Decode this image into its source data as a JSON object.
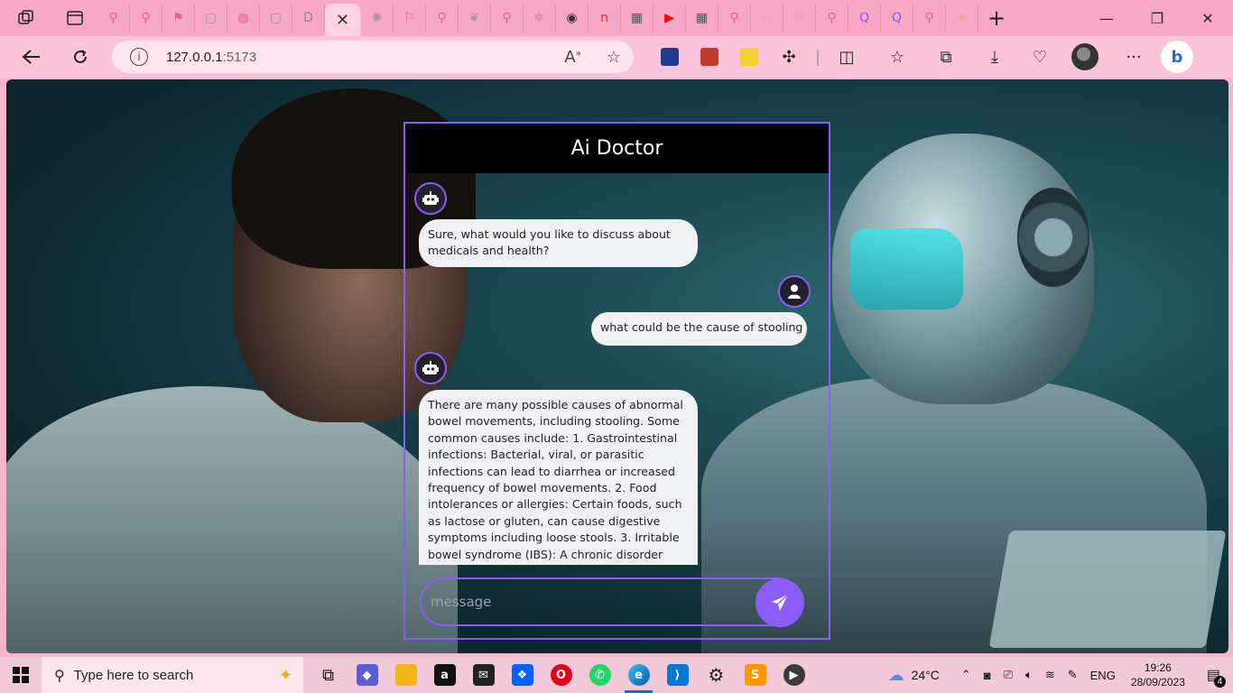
{
  "browser": {
    "tabs": [
      {
        "icon": "search-icon",
        "color": "#e06090"
      },
      {
        "icon": "search-icon",
        "color": "#e06090"
      },
      {
        "icon": "pin-icon",
        "color": "#e06090"
      },
      {
        "icon": "document-icon",
        "color": "#999999"
      },
      {
        "icon": "globe-icon",
        "color": "#e06090"
      },
      {
        "icon": "document-icon",
        "color": "#999999"
      },
      {
        "icon": "d-letter-icon",
        "color": "#888888"
      },
      {
        "icon": "close-icon",
        "color": "#333333",
        "active": true
      },
      {
        "icon": "openai-icon",
        "color": "#999999"
      },
      {
        "icon": "flag-icon",
        "color": "#e06090"
      },
      {
        "icon": "search-icon",
        "color": "#e06090"
      },
      {
        "icon": "leaf-icon",
        "color": "#999999"
      },
      {
        "icon": "search-icon",
        "color": "#e06090"
      },
      {
        "icon": "react-icon",
        "color": "#e06090"
      },
      {
        "icon": "meet-icon",
        "color": "#333333"
      },
      {
        "icon": "n-letter-icon",
        "color": "#d03030"
      },
      {
        "icon": "table-icon",
        "color": "#555555"
      },
      {
        "icon": "youtube-icon",
        "color": "#ff0000"
      },
      {
        "icon": "table-icon",
        "color": "#555555"
      },
      {
        "icon": "search-icon",
        "color": "#e06090"
      },
      {
        "icon": "sort-icon",
        "color": "#ff9bbb"
      },
      {
        "icon": "sort-icon",
        "color": "#ff9bbb"
      },
      {
        "icon": "search-icon",
        "color": "#e06090"
      },
      {
        "icon": "q-letter-icon",
        "color": "#7b5cf0"
      },
      {
        "icon": "q-letter-icon",
        "color": "#7b5cf0"
      },
      {
        "icon": "search-icon",
        "color": "#e06090"
      },
      {
        "icon": "star-icon",
        "color": "#ff9b7a"
      }
    ],
    "address": {
      "host": "127.0.0.1",
      "port": ":5173"
    }
  },
  "app": {
    "title": "Ai Doctor",
    "messages": [
      {
        "sender": "bot",
        "text": "Sure, what would you like to discuss about medicals and health?"
      },
      {
        "sender": "user",
        "text": "what could be the cause of stooling"
      },
      {
        "sender": "bot",
        "text": "There are many possible causes of abnormal bowel movements, including stooling. Some common causes include: 1. Gastrointestinal infections: Bacterial, viral, or parasitic infections can lead to diarrhea or increased frequency of bowel movements. 2. Food intolerances or allergies: Certain foods, such as lactose or gluten, can cause digestive symptoms including loose stools. 3. Irritable bowel syndrome (IBS): A chronic disorder"
      }
    ],
    "input": {
      "placeholder": "message",
      "value": ""
    },
    "accent": "#8b5cf6"
  },
  "taskbar": {
    "search_placeholder": "Type here to search",
    "weather": "24°C",
    "language": "ENG",
    "time": "19:26",
    "date": "28/09/2023",
    "notification_count": "4"
  }
}
